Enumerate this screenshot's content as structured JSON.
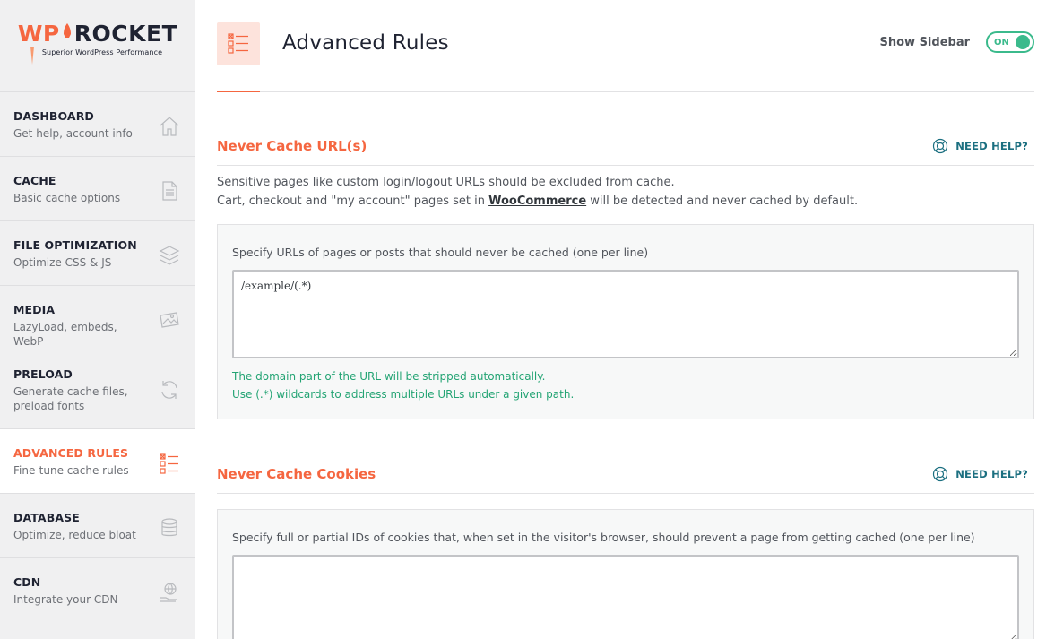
{
  "logo": {
    "wp": "WP",
    "rocket": "ROCKET",
    "tagline": "Superior WordPress Performance"
  },
  "nav": [
    {
      "title": "DASHBOARD",
      "subtitle": "Get help, account info",
      "icon": "home-icon"
    },
    {
      "title": "CACHE",
      "subtitle": "Basic cache options",
      "icon": "page-icon"
    },
    {
      "title": "FILE OPTIMIZATION",
      "subtitle": "Optimize CSS & JS",
      "icon": "layers-icon"
    },
    {
      "title": "MEDIA",
      "subtitle": "LazyLoad, embeds, WebP",
      "icon": "image-icon"
    },
    {
      "title": "PRELOAD",
      "subtitle": "Generate cache files, preload fonts",
      "icon": "refresh-icon"
    },
    {
      "title": "ADVANCED RULES",
      "subtitle": "Fine-tune cache rules",
      "icon": "checklist-icon",
      "active": true
    },
    {
      "title": "DATABASE",
      "subtitle": "Optimize, reduce bloat",
      "icon": "database-icon"
    },
    {
      "title": "CDN",
      "subtitle": "Integrate your CDN",
      "icon": "globe-hand-icon"
    }
  ],
  "header": {
    "title": "Advanced Rules",
    "sidebar_label": "Show Sidebar",
    "toggle_state": "ON"
  },
  "sections": [
    {
      "title": "Never Cache URL(s)",
      "help": "NEED HELP?",
      "desc_line1": "Sensitive pages like custom login/logout URLs should be excluded from cache.",
      "desc_line2_pre": "Cart, checkout and \"my account\" pages set in ",
      "desc_line2_link": "WooCommerce",
      "desc_line2_post": " will be detected and never cached by default.",
      "field_label": "Specify URLs of pages or posts that should never be cached (one per line)",
      "value": "/example/(.*)",
      "hint1": "The domain part of the URL will be stripped automatically.",
      "hint2": "Use (.*) wildcards to address multiple URLs under a given path."
    },
    {
      "title": "Never Cache Cookies",
      "help": "NEED HELP?",
      "field_label": "Specify full or partial IDs of cookies that, when set in the visitor's browser, should prevent a page from getting cached (one per line)",
      "value": ""
    }
  ],
  "colors": {
    "accent": "#f56640",
    "toggle": "#3bba8c",
    "help": "#1b6f80",
    "hint": "#24a474",
    "sidebar_bg": "#f0f0f1"
  }
}
